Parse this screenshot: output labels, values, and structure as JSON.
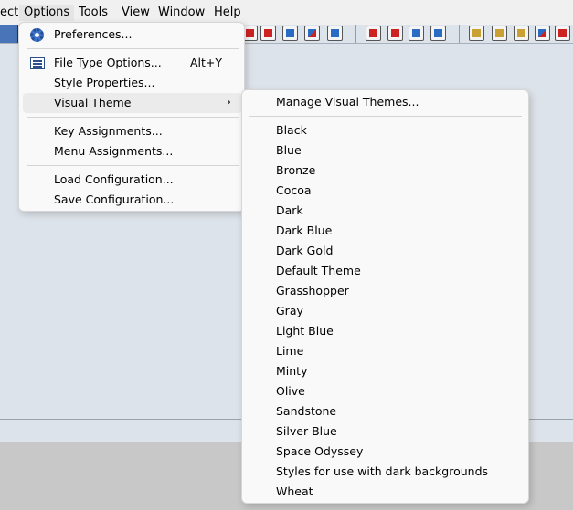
{
  "menubar": {
    "items": [
      "ect",
      "Options",
      "Tools",
      "View",
      "Window",
      "Help"
    ]
  },
  "options_menu": {
    "preferences": "Preferences...",
    "file_type_options": "File Type Options...",
    "file_type_options_accel": "Alt+Y",
    "style_properties": "Style Properties...",
    "visual_theme": "Visual Theme",
    "visual_theme_chevron": "›",
    "key_assignments": "Key Assignments...",
    "menu_assignments": "Menu Assignments...",
    "load_configuration": "Load Configuration...",
    "save_configuration": "Save Configuration..."
  },
  "theme_menu": {
    "manage": "Manage Visual Themes...",
    "themes": [
      "Black",
      "Blue",
      "Bronze",
      "Cocoa",
      "Dark",
      "Dark Blue",
      "Dark Gold",
      "Default Theme",
      "Grasshopper",
      "Gray",
      "Light Blue",
      "Lime",
      "Minty",
      "Olive",
      "Sandstone",
      "Silver Blue",
      "Space Odyssey",
      "Styles for use with dark backgrounds",
      "Wheat"
    ]
  },
  "toolbar": {
    "icons": [
      "red-arrow-up-icon",
      "red-arrow-down-icon",
      "zoom-icon",
      "replace-xy-icon",
      "www-icon",
      "red-arrows-icon",
      "red-arrows-2-icon",
      "outdent-icon",
      "star-icon",
      "hand-icon",
      "bookmark-icon",
      "book-icon",
      "fx-icon",
      "red-up-arrow-icon"
    ]
  }
}
